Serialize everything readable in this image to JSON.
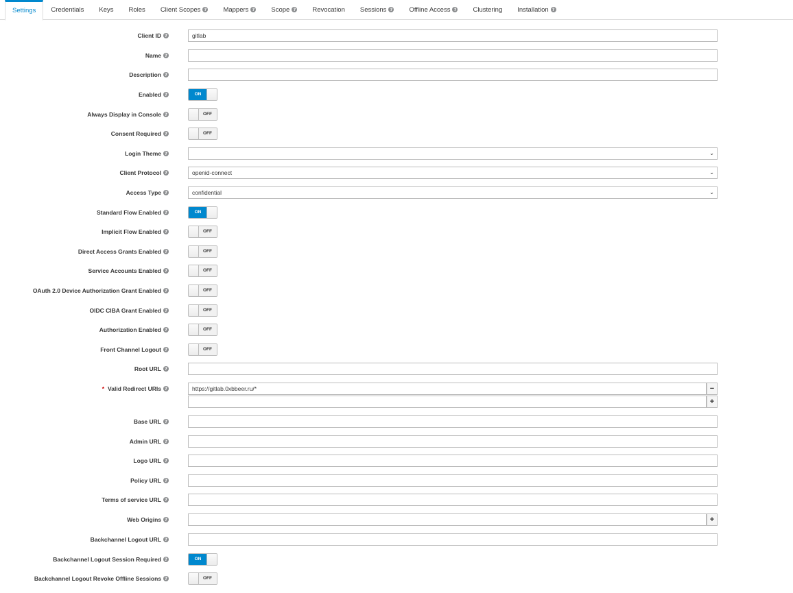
{
  "tabs": [
    {
      "label": "Settings",
      "help": false,
      "active": true
    },
    {
      "label": "Credentials",
      "help": false
    },
    {
      "label": "Keys",
      "help": false
    },
    {
      "label": "Roles",
      "help": false
    },
    {
      "label": "Client Scopes",
      "help": true
    },
    {
      "label": "Mappers",
      "help": true
    },
    {
      "label": "Scope",
      "help": true
    },
    {
      "label": "Revocation",
      "help": false
    },
    {
      "label": "Sessions",
      "help": true
    },
    {
      "label": "Offline Access",
      "help": true
    },
    {
      "label": "Clustering",
      "help": false
    },
    {
      "label": "Installation",
      "help": true
    }
  ],
  "help_glyph": "?",
  "toggle_text": {
    "on": "ON",
    "off": "OFF"
  },
  "fields": {
    "client_id": {
      "label": "Client ID",
      "value": "gitlab"
    },
    "name": {
      "label": "Name",
      "value": ""
    },
    "description": {
      "label": "Description",
      "value": ""
    },
    "enabled": {
      "label": "Enabled",
      "state": "on"
    },
    "always_display": {
      "label": "Always Display in Console",
      "state": "off"
    },
    "consent_required": {
      "label": "Consent Required",
      "state": "off"
    },
    "login_theme": {
      "label": "Login Theme",
      "value": ""
    },
    "client_protocol": {
      "label": "Client Protocol",
      "value": "openid-connect"
    },
    "access_type": {
      "label": "Access Type",
      "value": "confidential"
    },
    "standard_flow": {
      "label": "Standard Flow Enabled",
      "state": "on"
    },
    "implicit_flow": {
      "label": "Implicit Flow Enabled",
      "state": "off"
    },
    "direct_access": {
      "label": "Direct Access Grants Enabled",
      "state": "off"
    },
    "service_accounts": {
      "label": "Service Accounts Enabled",
      "state": "off"
    },
    "device_grant": {
      "label": "OAuth 2.0 Device Authorization Grant Enabled",
      "state": "off"
    },
    "ciba_grant": {
      "label": "OIDC CIBA Grant Enabled",
      "state": "off"
    },
    "authorization": {
      "label": "Authorization Enabled",
      "state": "off"
    },
    "front_channel_logout": {
      "label": "Front Channel Logout",
      "state": "off"
    },
    "root_url": {
      "label": "Root URL",
      "value": ""
    },
    "valid_redirect_uris": {
      "label": "Valid Redirect URIs",
      "required_mark": "*",
      "values": [
        "https://gitlab.0xbbeer.ru/*",
        ""
      ]
    },
    "base_url": {
      "label": "Base URL",
      "value": ""
    },
    "admin_url": {
      "label": "Admin URL",
      "value": ""
    },
    "logo_url": {
      "label": "Logo URL",
      "value": ""
    },
    "policy_url": {
      "label": "Policy URL",
      "value": ""
    },
    "tos_url": {
      "label": "Terms of service URL",
      "value": ""
    },
    "web_origins": {
      "label": "Web Origins",
      "value": ""
    },
    "backchannel_logout_url": {
      "label": "Backchannel Logout URL",
      "value": ""
    },
    "backchannel_session_required": {
      "label": "Backchannel Logout Session Required",
      "state": "on"
    },
    "backchannel_revoke_offline": {
      "label": "Backchannel Logout Revoke Offline Sessions",
      "state": "off"
    }
  },
  "buttons": {
    "remove": "−",
    "add": "+"
  },
  "chevron": "⌄",
  "colors": {
    "accent": "#0088ce",
    "required": "#cc0000"
  }
}
